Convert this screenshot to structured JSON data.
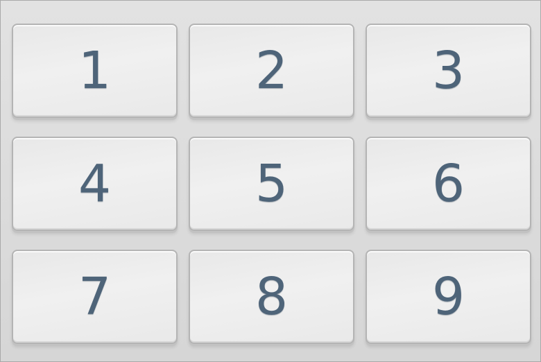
{
  "keypad": {
    "keys": [
      {
        "label": "1"
      },
      {
        "label": "2"
      },
      {
        "label": "3"
      },
      {
        "label": "4"
      },
      {
        "label": "5"
      },
      {
        "label": "6"
      },
      {
        "label": "7"
      },
      {
        "label": "8"
      },
      {
        "label": "9"
      }
    ]
  },
  "colors": {
    "digit": "#4e6479",
    "key_face": "#ececec",
    "key_border": "#b4b4b4",
    "background": "#dcdcdc"
  }
}
